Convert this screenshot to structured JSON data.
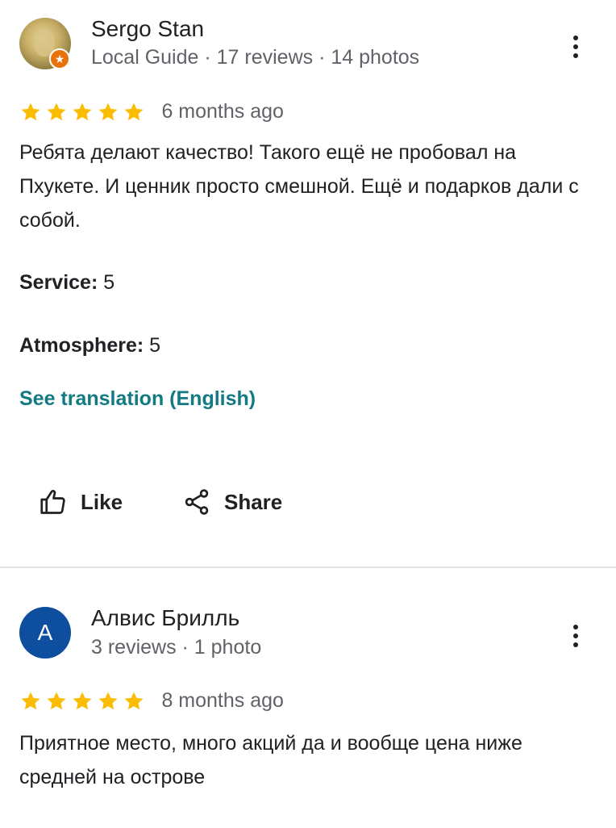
{
  "reviews": [
    {
      "author": "Sergo Stan",
      "meta": "Local Guide · 17 reviews · 14 photos",
      "rating": 5,
      "date": "6 months ago",
      "text": "Ребята делают качество! Такого ещё не пробовал на Пхукете. И ценник просто смешной. Ещё и подарков дали с собой.",
      "attributes": [
        {
          "label": "Service:",
          "value": "5"
        },
        {
          "label": "Atmosphere:",
          "value": "5"
        }
      ],
      "translate_link": "See translation (English)",
      "actions": {
        "like": "Like",
        "share": "Share"
      }
    },
    {
      "author": "Алвис Брилль",
      "avatar_letter": "A",
      "meta": "3 reviews · 1 photo",
      "rating": 5,
      "date": "8 months ago",
      "text": "Приятное место, много акций да и вообще цена ниже средней на острове"
    }
  ],
  "colors": {
    "star": "#fbbc04",
    "link": "#137a84",
    "avatar_bg": "#0d4e9e",
    "local_guide_badge": "#e8710a",
    "meta_text": "#5f6368"
  },
  "icons": {
    "like": "thumb-up-icon",
    "share": "share-icon",
    "menu": "more-vert-icon",
    "star": "star-icon",
    "badge": "local-guide-badge-icon"
  }
}
